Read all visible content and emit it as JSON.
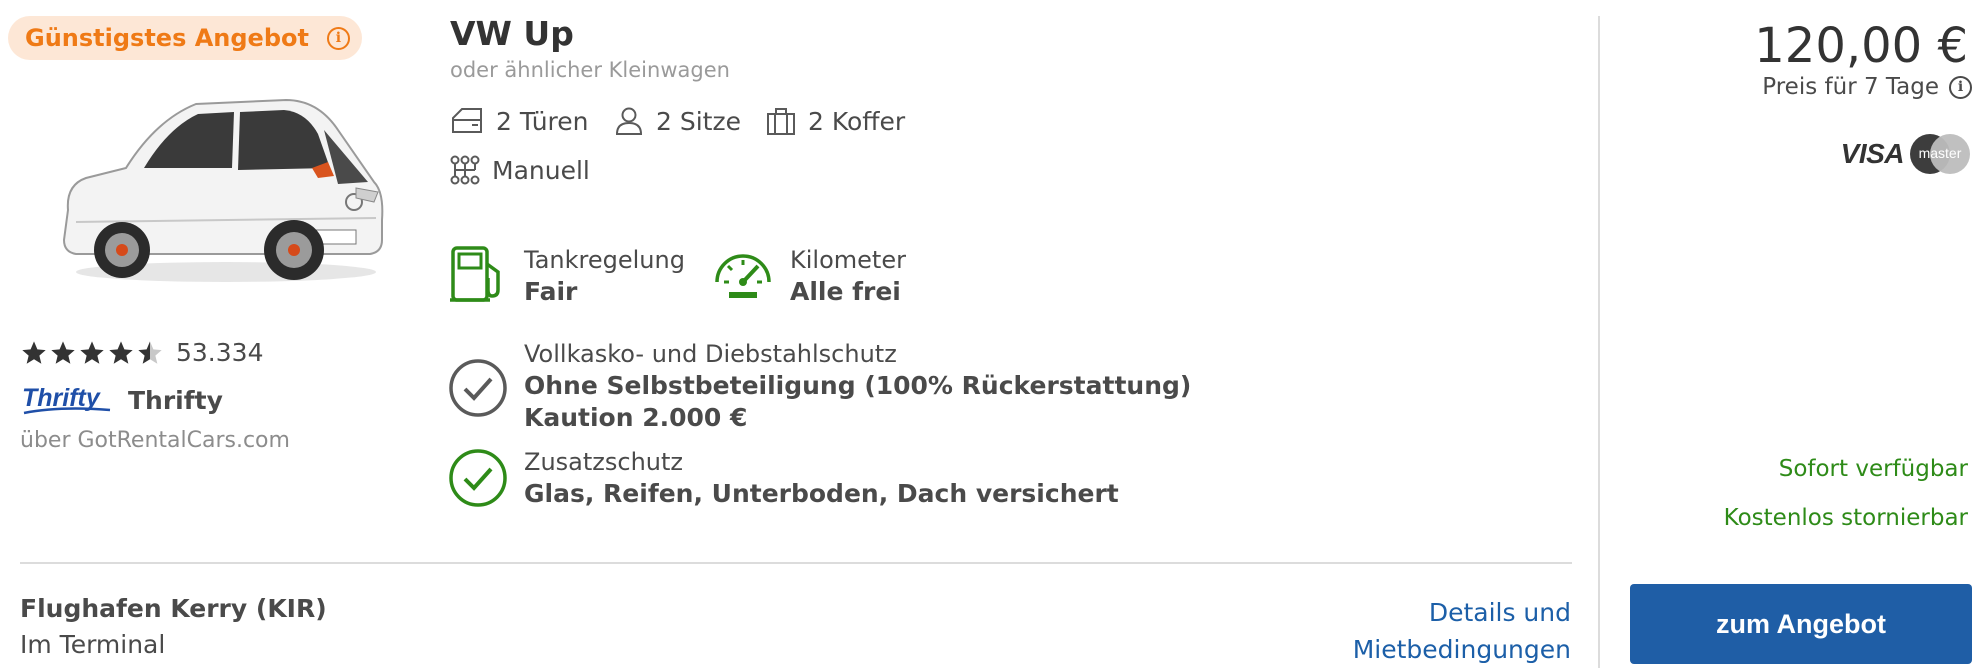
{
  "badge": {
    "label": "Günstigstes Angebot",
    "info_icon": "info-icon"
  },
  "car": {
    "name": "VW Up",
    "category": "oder ähnlicher Kleinwagen",
    "features": {
      "doors": "2 Türen",
      "seats": "2 Sitze",
      "luggage": "2 Koffer",
      "transmission": "Manuell"
    }
  },
  "rating": {
    "stars": 4.5,
    "count": "53.334"
  },
  "supplier": {
    "logo_text": "Thrifty",
    "name": "Thrifty",
    "via": "über GotRentalCars.com"
  },
  "fuel_policy": {
    "label": "Tankregelung",
    "value": "Fair"
  },
  "mileage": {
    "label": "Kilometer",
    "value": "Alle frei"
  },
  "insurance": {
    "label": "Vollkasko- und Diebstahlschutz",
    "value": "Ohne Selbstbeteiligung (100% Rückerstattung)",
    "deposit": "Kaution 2.000 €"
  },
  "extra_protection": {
    "label": "Zusatzschutz",
    "value": "Glas, Reifen, Unterboden, Dach versichert"
  },
  "pickup": {
    "location": "Flughafen Kerry (KIR)",
    "detail": "Im Terminal"
  },
  "details_link": {
    "line1": "Details und",
    "line2": "Mietbedingungen"
  },
  "price": {
    "amount": "120,00 €",
    "period": "Preis für 7 Tage"
  },
  "payments": {
    "visa": "VISA",
    "master": "master"
  },
  "availability": {
    "instant": "Sofort verfügbar",
    "cancellation": "Kostenlos stornierbar"
  },
  "cta": {
    "label": "zum Angebot"
  },
  "colors": {
    "badge_orange": "#ef7a16",
    "badge_bg": "#fde7d6",
    "green": "#2e8b18",
    "link_blue": "#1c5fa8",
    "button_blue": "#1f5ea6"
  }
}
